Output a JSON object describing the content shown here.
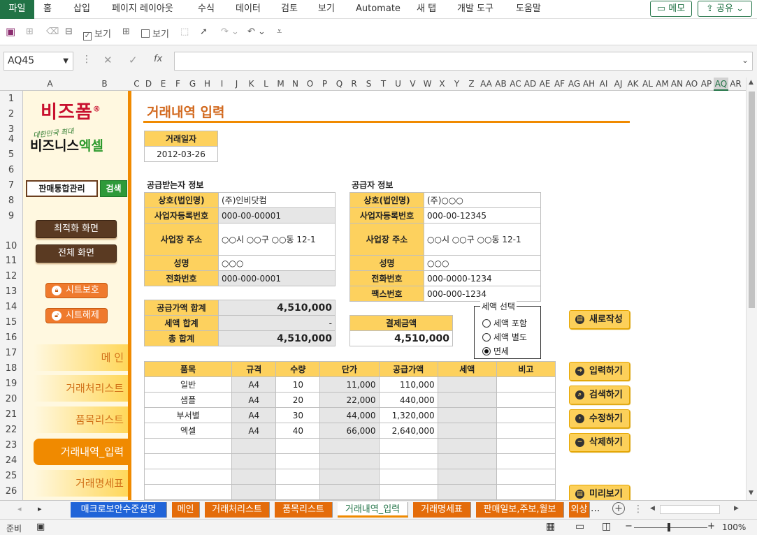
{
  "ribbon": {
    "tabs": [
      "파일",
      "홈",
      "삽입",
      "페이지 레이아웃",
      "수식",
      "데이터",
      "검토",
      "보기",
      "Automate",
      "새 탭",
      "개발 도구",
      "도움말"
    ],
    "memo": "메모",
    "share": "공유"
  },
  "qat": {
    "view1": "보기",
    "view2": "보기"
  },
  "formula": {
    "namebox": "AQ45",
    "fx": "fx",
    "value": ""
  },
  "columns": [
    "A",
    "B",
    "C",
    "D",
    "E",
    "F",
    "G",
    "H",
    "I",
    "J",
    "K",
    "L",
    "M",
    "N",
    "O",
    "P",
    "Q",
    "R",
    "S",
    "T",
    "U",
    "V",
    "W",
    "X",
    "Y",
    "Z",
    "AA",
    "AB",
    "AC",
    "AD",
    "AE",
    "AF",
    "AG",
    "AH",
    "AI",
    "AJ",
    "AK",
    "AL",
    "AM",
    "AN",
    "AO",
    "AP",
    "AQ",
    "AR"
  ],
  "rows": [
    "1",
    "2",
    "3",
    "4",
    "5",
    "6",
    "7",
    "8",
    "9",
    "10",
    "11",
    "12",
    "13",
    "14",
    "15",
    "16",
    "17",
    "18",
    "19",
    "20",
    "21",
    "22",
    "23",
    "24",
    "25",
    "26"
  ],
  "sidebar": {
    "logo_main": "비즈폼",
    "logo_reg": "®",
    "logo_sub": "대한민국 최대",
    "logo_brand1": "비즈니스",
    "logo_brand2": "엑셀",
    "search_value": "판매통합관리",
    "search_button": "검색",
    "btn_optimal": "최적화 화면",
    "btn_full": "전체 화면",
    "btn_protect": "시트보호",
    "btn_unprotect": "시트해제",
    "menu": [
      "메 인",
      "거래처리스트",
      "품목리스트",
      "거래내역_입력",
      "거래명세표"
    ]
  },
  "page": {
    "title": "거래내역 입력",
    "date_label": "거래일자",
    "date_value": "2012-03-26",
    "buyer_title": "공급받는자 정보",
    "supplier_title": "공급자 정보",
    "buyer": {
      "name_label": "상호(법인명)",
      "name": "(주)인비닷컴",
      "reg_label": "사업자등록번호",
      "reg": "000-00-00001",
      "addr_label": "사업장 주소",
      "addr": "○○시 ○○구 ○○동 12-1",
      "owner_label": "성명",
      "owner": "○○○",
      "phone_label": "전화번호",
      "phone": "000-000-0001"
    },
    "supplier": {
      "name_label": "상호(법인명)",
      "name": "(주)○○○",
      "reg_label": "사업자등록번호",
      "reg": "000-00-12345",
      "addr_label": "사업장 주소",
      "addr": "○○시 ○○구 ○○동 12-1",
      "owner_label": "성명",
      "owner": "○○○",
      "phone_label": "전화번호",
      "phone": "000-0000-1234",
      "fax_label": "팩스번호",
      "fax": "000-000-1234"
    },
    "totals": {
      "supply_label": "공급가액 합계",
      "supply": "4,510,000",
      "tax_label": "세액 합계",
      "tax": "-",
      "total_label": "총 합계",
      "total": "4,510,000"
    },
    "payment": {
      "label": "결제금액",
      "value": "4,510,000"
    },
    "tax_group": {
      "legend": "세액 선택",
      "opt1": "세액 포함",
      "opt2": "세액 별도",
      "opt3": "면세",
      "selected": "면세"
    },
    "buttons": {
      "new": "새로작성",
      "input": "입력하기",
      "search": "검색하기",
      "edit": "수정하기",
      "delete": "삭제하기",
      "preview": "미리보기"
    },
    "items_header": [
      "품목",
      "규격",
      "수량",
      "단가",
      "공급가액",
      "세액",
      "비고"
    ],
    "items": [
      [
        "일반",
        "A4",
        "10",
        "11,000",
        "110,000",
        "",
        ""
      ],
      [
        "샘플",
        "A4",
        "20",
        "22,000",
        "440,000",
        "",
        ""
      ],
      [
        "부서별",
        "A4",
        "30",
        "44,000",
        "1,320,000",
        "",
        ""
      ],
      [
        "엑셀",
        "A4",
        "40",
        "66,000",
        "2,640,000",
        "",
        ""
      ],
      [
        "",
        "",
        "",
        "",
        "",
        "",
        ""
      ],
      [
        "",
        "",
        "",
        "",
        "",
        "",
        ""
      ],
      [
        "",
        "",
        "",
        "",
        "",
        "",
        ""
      ],
      [
        "",
        "",
        "",
        "",
        "",
        "",
        ""
      ]
    ]
  },
  "sheet_tabs": [
    "매크로보안수준설명",
    "메인",
    "거래처리스트",
    "품목리스트",
    "거래내역_입력",
    "거래명세표",
    "판매일보,주보,월보",
    "외상"
  ],
  "active_sheet": "거래내역_입력",
  "tabs_more": "...",
  "status": {
    "ready": "준비",
    "zoom": "100%"
  },
  "colors": {
    "excel_green": "#217346",
    "accent_orange": "#f08a00",
    "label_yellow": "#fdd15e"
  }
}
